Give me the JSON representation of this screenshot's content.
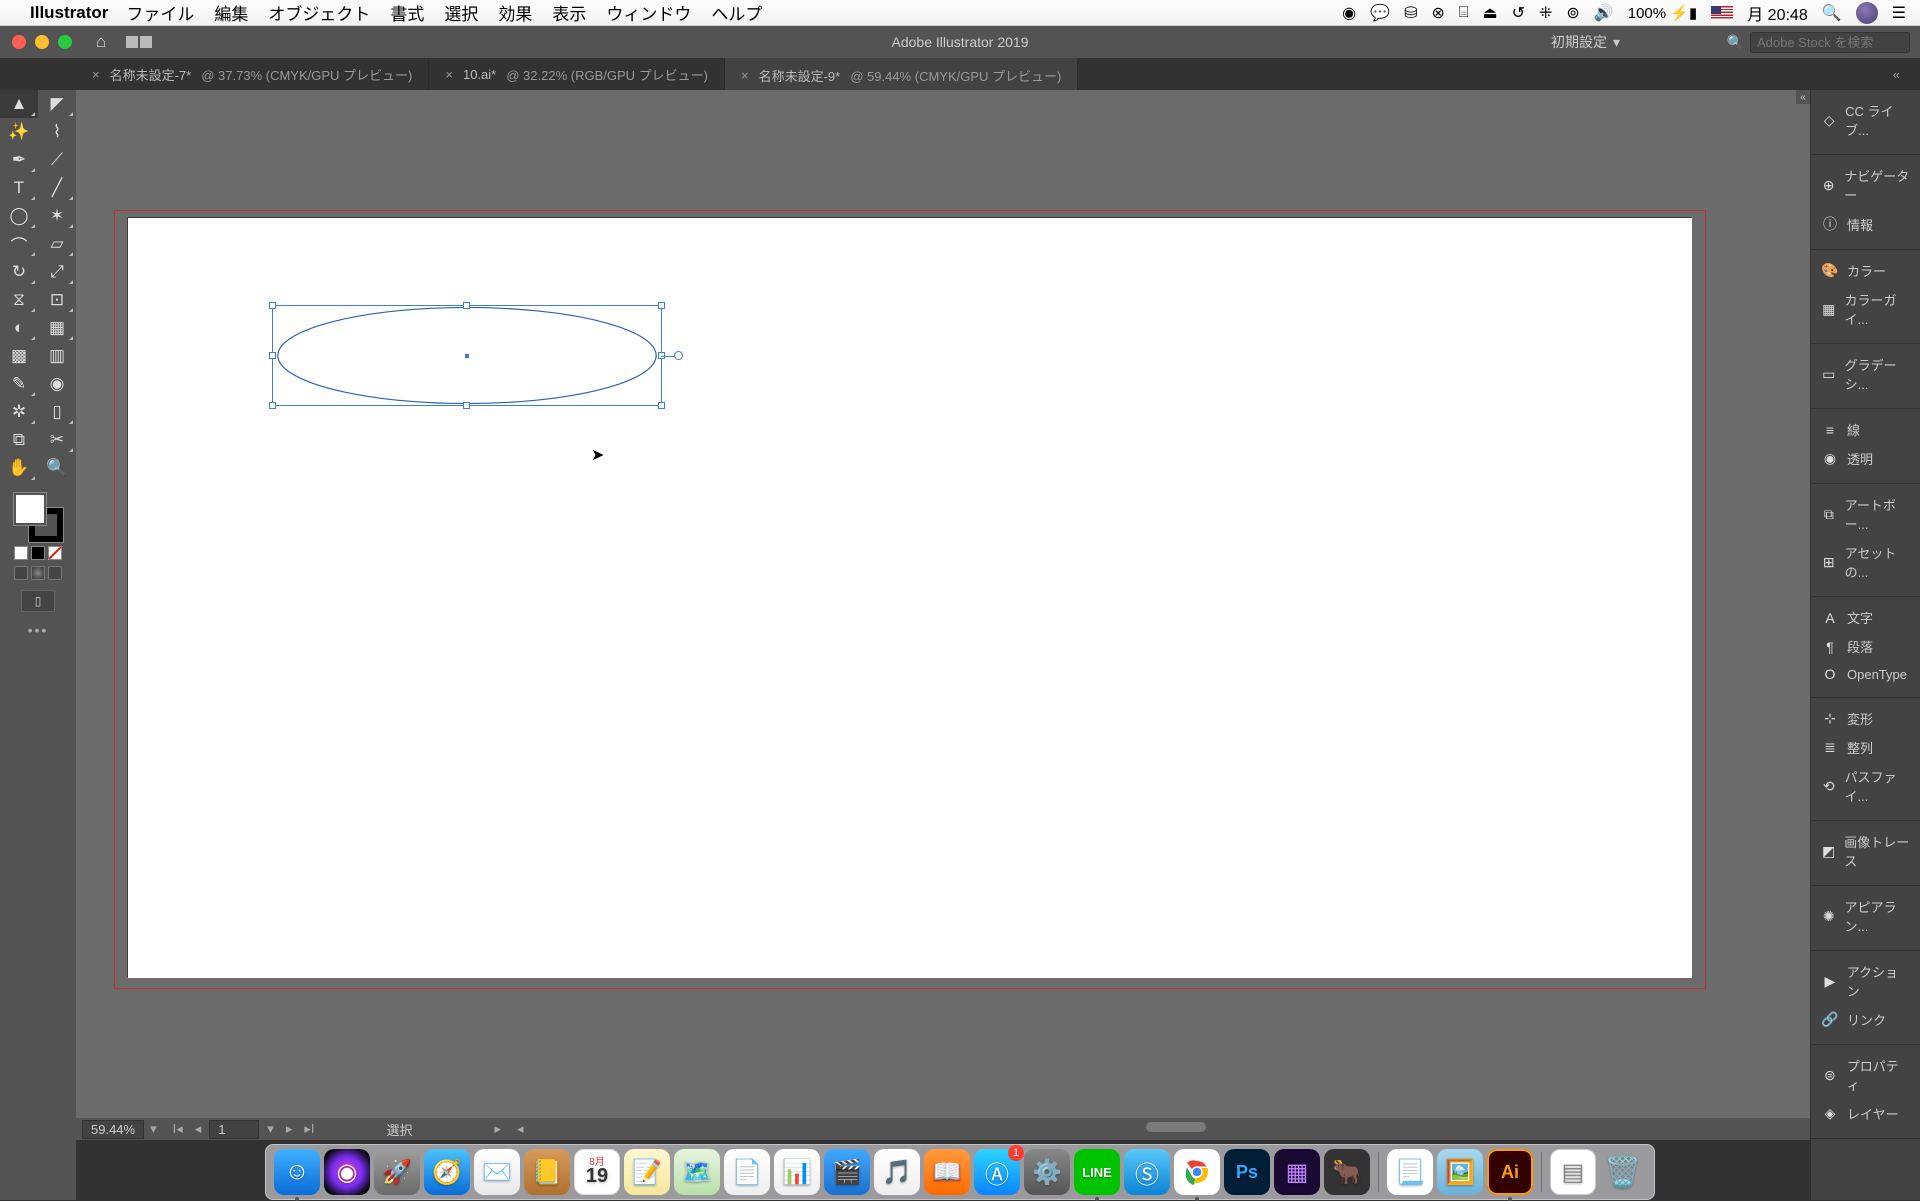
{
  "menubar": {
    "app": "Illustrator",
    "items": [
      "ファイル",
      "編集",
      "オブジェクト",
      "書式",
      "選択",
      "効果",
      "表示",
      "ウィンドウ",
      "ヘルプ"
    ],
    "battery": "100%",
    "clock": "月 20:48"
  },
  "titlebar": {
    "title": "Adobe Illustrator 2019",
    "workspace": "初期設定",
    "search_placeholder": "Adobe Stock を検索"
  },
  "tabs": [
    {
      "name": "名称未設定-7*",
      "zoom": "37.73%",
      "mode": "(CMYK/GPU プレビュー)",
      "active": false
    },
    {
      "name": "10.ai*",
      "zoom": "32.22%",
      "mode": "(RGB/GPU プレビュー)",
      "active": false
    },
    {
      "name": "名称未設定-9*",
      "zoom": "59.44%",
      "mode": "(CMYK/GPU プレビュー)",
      "active": true
    }
  ],
  "statusbar": {
    "zoom": "59.44%",
    "artboard": "1",
    "tool": "選択"
  },
  "right_panels": [
    {
      "group": [
        {
          "icon": "◇",
          "label": "CC ライブ..."
        }
      ]
    },
    {
      "group": [
        {
          "icon": "⊕",
          "label": "ナビゲーター"
        },
        {
          "icon": "ⓘ",
          "label": "情報"
        }
      ]
    },
    {
      "group": [
        {
          "icon": "🎨",
          "label": "カラー"
        },
        {
          "icon": "▦",
          "label": "カラーガイ..."
        }
      ]
    },
    {
      "group": [
        {
          "icon": "▭",
          "label": "グラデーシ..."
        }
      ]
    },
    {
      "group": [
        {
          "icon": "≡",
          "label": "線"
        },
        {
          "icon": "◉",
          "label": "透明"
        }
      ]
    },
    {
      "group": [
        {
          "icon": "⧉",
          "label": "アートボー..."
        },
        {
          "icon": "⊞",
          "label": "アセットの..."
        }
      ]
    },
    {
      "group": [
        {
          "icon": "A",
          "label": "文字"
        },
        {
          "icon": "¶",
          "label": "段落"
        },
        {
          "icon": "O",
          "label": "OpenType"
        }
      ]
    },
    {
      "group": [
        {
          "icon": "⊹",
          "label": "変形"
        },
        {
          "icon": "≣",
          "label": "整列"
        },
        {
          "icon": "⟲",
          "label": "パスファイ..."
        }
      ]
    },
    {
      "group": [
        {
          "icon": "◩",
          "label": "画像トレース"
        }
      ]
    },
    {
      "group": [
        {
          "icon": "✺",
          "label": "アピアラン..."
        }
      ]
    },
    {
      "group": [
        {
          "icon": "▶",
          "label": "アクション"
        },
        {
          "icon": "🔗",
          "label": "リンク"
        }
      ]
    },
    {
      "group": [
        {
          "icon": "⊜",
          "label": "プロパティ"
        },
        {
          "icon": "◈",
          "label": "レイヤー"
        }
      ]
    }
  ],
  "tools_left": [
    "▲",
    "◤",
    "⤳",
    "✎",
    "✒",
    "⟋",
    "T",
    "╱",
    "◯",
    "✶",
    "⌒",
    "✐",
    "◢",
    "⧉",
    "⊡",
    "▦",
    "◉",
    "✂",
    "⇄",
    "✥",
    "✋",
    "🔍"
  ],
  "dock": {
    "cal_day": "19",
    "appstore_badge": "1"
  }
}
